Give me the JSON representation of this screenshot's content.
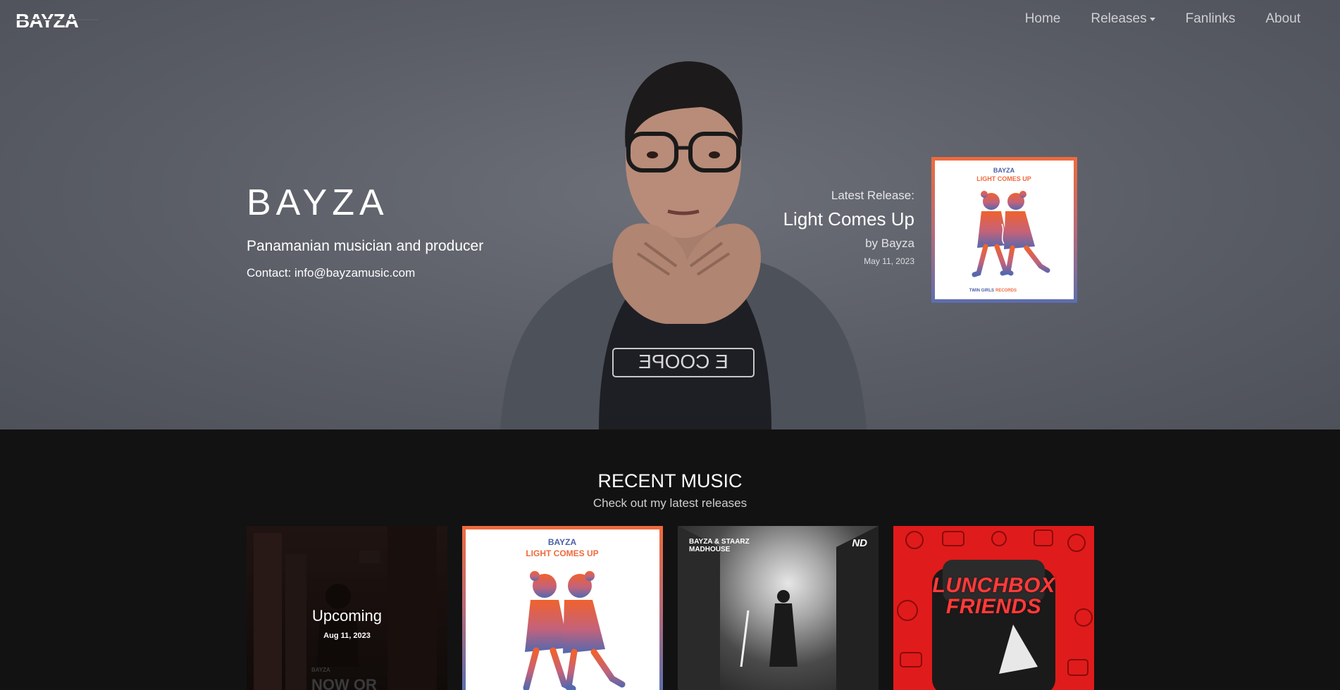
{
  "nav": {
    "logo": "BAYZA",
    "items": [
      {
        "label": "Home"
      },
      {
        "label": "Releases"
      },
      {
        "label": "Fanlinks"
      },
      {
        "label": "About"
      }
    ]
  },
  "hero": {
    "artist_name": "BAYZA",
    "tagline": "Panamanian musician and producer",
    "contact": "Contact: info@bayzamusic.com",
    "latest_release": {
      "label": "Latest Release:",
      "title": "Light Comes Up",
      "by": "by Bayza",
      "date": "May 11, 2023",
      "cover": {
        "artist": "BAYZA",
        "title": "LIGHT COMES UP",
        "label_part1": "TWIN GIRLS",
        "label_part2": "RECORDS"
      }
    },
    "shirt_text": "E COOPE"
  },
  "recent": {
    "title": "RECENT MUSIC",
    "subtitle": "Check out my latest releases",
    "cards": [
      {
        "label": "Upcoming",
        "date": "Aug 11, 2023",
        "cover_text": "NOW OR",
        "cover_artist": "BAYZA"
      },
      {
        "artist": "BAYZA",
        "title": "LIGHT COMES UP"
      },
      {
        "artists": "BAYZA & STAARZ",
        "title": "MADHOUSE",
        "badge": "ND"
      },
      {
        "title_line1": "LUNCHBOX",
        "title_line2": "FRIENDS"
      }
    ]
  },
  "colors": {
    "accent_orange": "#f06a3c",
    "accent_blue": "#5c6eb0",
    "lunch_red": "#e01b1b",
    "background_dark": "#121212"
  }
}
